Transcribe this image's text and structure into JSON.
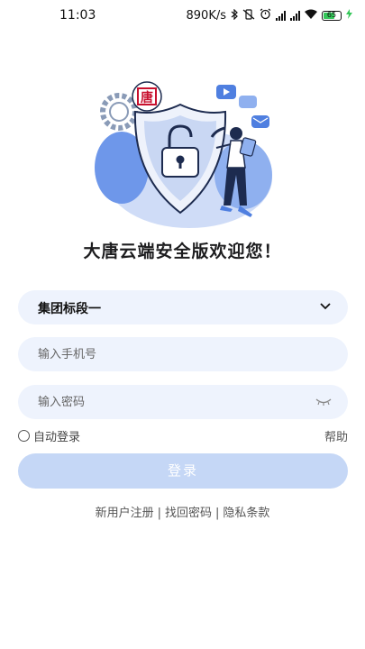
{
  "status_bar": {
    "time": "11:03",
    "speed": "890K/s",
    "battery": "65"
  },
  "welcome_text": "大唐云端安全版欢迎您！",
  "logo_text": "唐",
  "group_select": {
    "selected": "集团标段一"
  },
  "phone_input": {
    "placeholder": "输入手机号"
  },
  "password_input": {
    "placeholder": "输入密码"
  },
  "auto_login_label": "自动登录",
  "help_label": "帮助",
  "login_button_label": "登录",
  "links": {
    "register": "新用户注册",
    "recover": "找回密码",
    "privacy": "隐私条款",
    "separator": "|"
  },
  "colors": {
    "accent": "#2f6fd9",
    "field_bg": "#eef3fd",
    "button_disabled": "#c5d7f6"
  }
}
